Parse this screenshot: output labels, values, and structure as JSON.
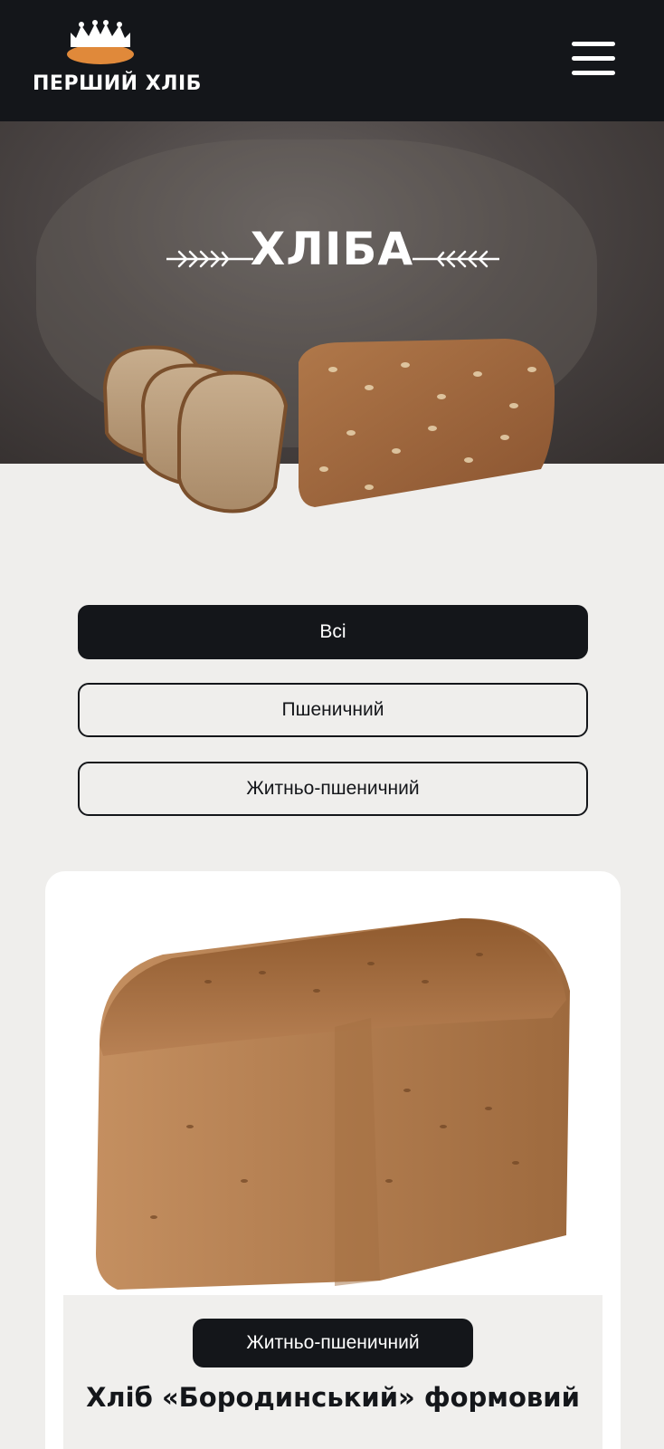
{
  "header": {
    "logo_text": "ПЕРШИЙ ХЛІБ",
    "logo_icon": "crown-bread-icon",
    "menu_icon": "hamburger-menu-icon"
  },
  "hero": {
    "title": "ХЛІБА"
  },
  "filters": [
    {
      "label": "Всі",
      "active": true
    },
    {
      "label": "Пшеничний",
      "active": false
    },
    {
      "label": "Житньо-пшеничний",
      "active": false
    }
  ],
  "product": {
    "category": "Житньо-пшеничний",
    "name": "Хліб «Бородинський» формовий"
  },
  "colors": {
    "header_bg": "#14161a",
    "page_bg": "#efeeec",
    "accent": "#e0893a"
  }
}
